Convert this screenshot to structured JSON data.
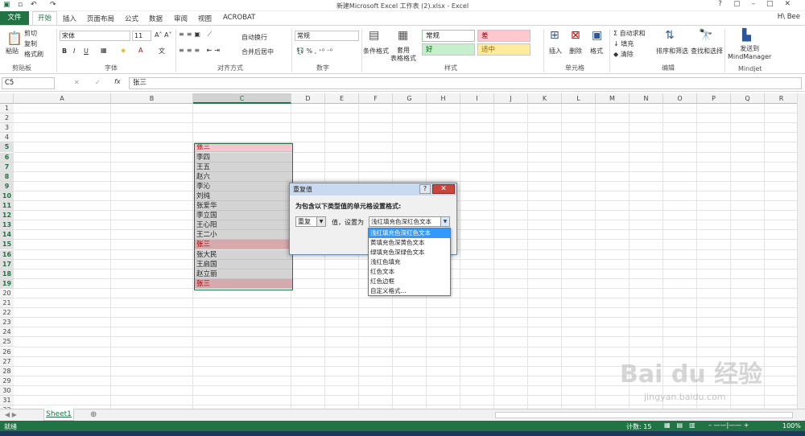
{
  "window": {
    "title": "新建Microsoft Excel 工作表 (2).xlsx - Excel",
    "user": "H\\ Bee"
  },
  "tabs": [
    "文件",
    "开始",
    "插入",
    "页面布局",
    "公式",
    "数据",
    "审阅",
    "视图",
    "ACROBAT"
  ],
  "ribbon": {
    "clipboard": {
      "label": "剪贴板",
      "paste": "粘贴",
      "cut": "剪切",
      "copy": "复制",
      "painter": "格式刷"
    },
    "font": {
      "label": "字体",
      "name": "宋体",
      "size": "11",
      "bold": "B",
      "italic": "I",
      "underline": "U"
    },
    "alignment": {
      "label": "对齐方式",
      "wrap": "自动换行",
      "merge": "合并后居中"
    },
    "number": {
      "label": "数字",
      "format": "常规"
    },
    "styles": {
      "label": "样式",
      "cond": "条件格式",
      "table": "套用\n表格格式",
      "normal": "常规",
      "bad": "差",
      "good": "好",
      "neutral": "适中"
    },
    "cells": {
      "label": "单元格",
      "insert": "插入",
      "delete": "删除",
      "format": "格式"
    },
    "editing": {
      "label": "编辑",
      "autosum": "自动求和",
      "fill": "填充",
      "clear": "清除",
      "sort": "排序和筛选",
      "find": "查找和选择"
    },
    "mindjet": {
      "label": "Mindjet",
      "send": "发送到\nMindManager"
    }
  },
  "formula_bar": {
    "name_box": "C5",
    "value": "张三"
  },
  "columns": [
    "A",
    "B",
    "C",
    "D",
    "E",
    "F",
    "G",
    "H",
    "I",
    "J",
    "K",
    "L",
    "M",
    "N",
    "O",
    "P",
    "Q",
    "R"
  ],
  "rows": [
    "1",
    "2",
    "3",
    "4",
    "5",
    "6",
    "7",
    "8",
    "9",
    "10",
    "11",
    "12",
    "13",
    "14",
    "15",
    "16",
    "17",
    "18",
    "19",
    "20",
    "21",
    "22",
    "23",
    "24",
    "25",
    "26",
    "27",
    "28",
    "29",
    "30",
    "31",
    "32"
  ],
  "cells": [
    {
      "row": 5,
      "value": "张三",
      "dup": true
    },
    {
      "row": 6,
      "value": "李四",
      "dup": false
    },
    {
      "row": 7,
      "value": "王五",
      "dup": false
    },
    {
      "row": 8,
      "value": "赵六",
      "dup": false
    },
    {
      "row": 9,
      "value": "李沁",
      "dup": false
    },
    {
      "row": 10,
      "value": "刘纯",
      "dup": false
    },
    {
      "row": 11,
      "value": "张爱华",
      "dup": false
    },
    {
      "row": 12,
      "value": "李立国",
      "dup": false
    },
    {
      "row": 13,
      "value": "王心阳",
      "dup": false
    },
    {
      "row": 14,
      "value": "王二小",
      "dup": false
    },
    {
      "row": 15,
      "value": "张三",
      "dup": true
    },
    {
      "row": 16,
      "value": "张大民",
      "dup": false
    },
    {
      "row": 17,
      "value": "王启国",
      "dup": false
    },
    {
      "row": 18,
      "value": "赵立丽",
      "dup": false
    },
    {
      "row": 19,
      "value": "张三",
      "dup": true
    }
  ],
  "dialog": {
    "title": "重复值",
    "heading": "为包含以下类型值的单元格设置格式:",
    "type_value": "重复",
    "mid_text": "值，设置为",
    "format_value": "浅红填充色深红色文本",
    "options": [
      "浅红填充色深红色文本",
      "黄填充色深黄色文本",
      "绿填充色深绿色文本",
      "浅红色填充",
      "红色文本",
      "红色边框",
      "自定义格式..."
    ]
  },
  "sheet": {
    "tab": "Sheet1"
  },
  "status": {
    "mode": "就绪",
    "count": "计数: 15",
    "zoom": "100%"
  },
  "watermark": {
    "brand": "Bai du 经验",
    "url": "jingyan.baidu.com"
  },
  "colors": {
    "excel_green": "#217346",
    "dup_fill": "#f4c7ce",
    "dup_text": "#9c0006"
  }
}
